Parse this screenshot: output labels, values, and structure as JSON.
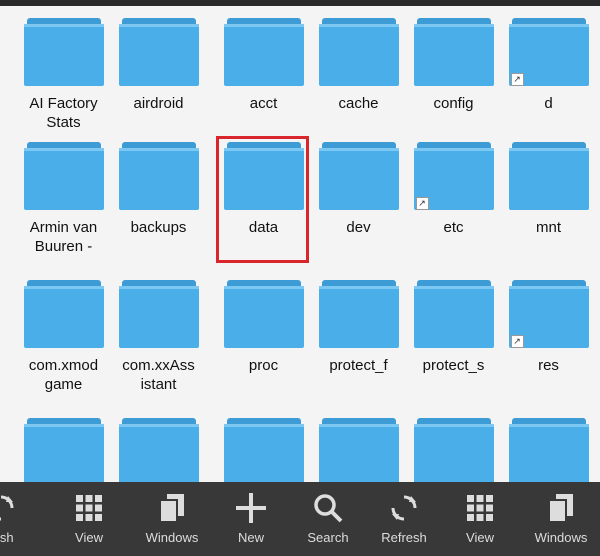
{
  "folders": [
    {
      "label": "AI Factory Stats",
      "link": false
    },
    {
      "label": "airdroid",
      "link": false
    },
    {
      "label": "acct",
      "link": false
    },
    {
      "label": "cache",
      "link": false
    },
    {
      "label": "config",
      "link": false
    },
    {
      "label": "d",
      "link": true
    },
    {
      "label": "Armin van Buuren -",
      "link": false
    },
    {
      "label": "backups",
      "link": false
    },
    {
      "label": "data",
      "link": false
    },
    {
      "label": "dev",
      "link": false
    },
    {
      "label": "etc",
      "link": true
    },
    {
      "label": "mnt",
      "link": false
    },
    {
      "label": "com.xmod game",
      "link": false
    },
    {
      "label": "com.xxAss istant",
      "link": false
    },
    {
      "label": "proc",
      "link": false
    },
    {
      "label": "protect_f",
      "link": false
    },
    {
      "label": "protect_s",
      "link": false
    },
    {
      "label": "res",
      "link": true
    },
    {
      "label": "",
      "link": false
    },
    {
      "label": "",
      "link": false
    },
    {
      "label": "",
      "link": false
    },
    {
      "label": "",
      "link": false
    },
    {
      "label": "",
      "link": false
    },
    {
      "label": "",
      "link": false
    }
  ],
  "toolbar": [
    {
      "label": "resh",
      "icon": "refresh-icon"
    },
    {
      "label": "View",
      "icon": "grid-view-icon"
    },
    {
      "label": "Windows",
      "icon": "windows-icon"
    },
    {
      "label": "New",
      "icon": "plus-icon"
    },
    {
      "label": "Search",
      "icon": "search-icon"
    },
    {
      "label": "Refresh",
      "icon": "refresh-icon"
    },
    {
      "label": "View",
      "icon": "grid-view-icon"
    },
    {
      "label": "Windows",
      "icon": "windows-icon"
    }
  ],
  "colors": {
    "folder": "#4aaee8",
    "highlight": "#d8262c",
    "toolbar_bg": "#383838"
  }
}
